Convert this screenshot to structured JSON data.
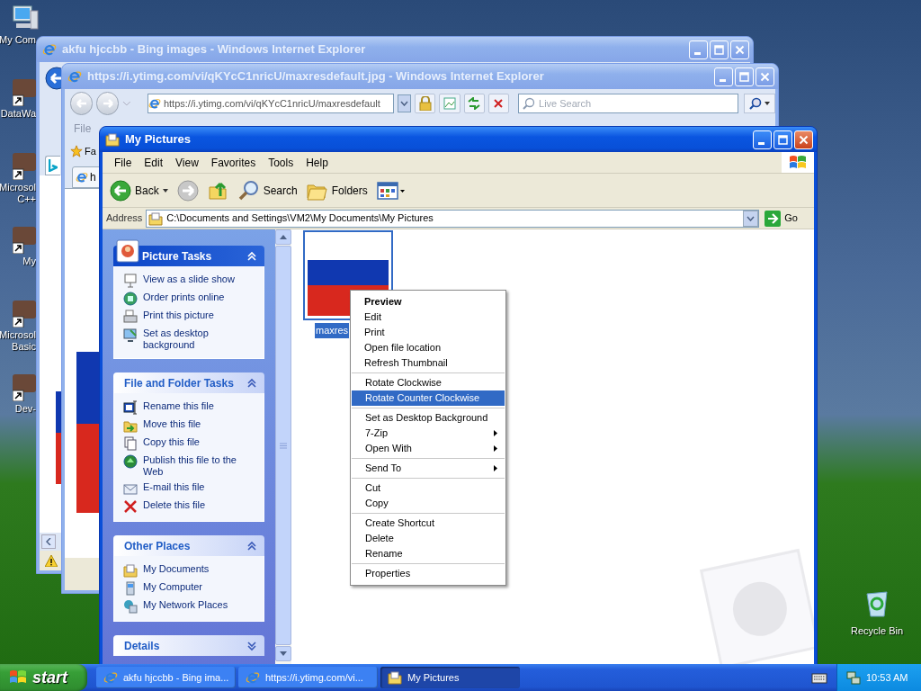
{
  "desktop": {
    "icons": [
      {
        "kind": "computer",
        "lines": [
          "My Com"
        ]
      },
      {
        "kind": "shortcut",
        "lines": [
          "DataWa"
        ]
      },
      {
        "kind": "shortcut",
        "lines": [
          "Microsol",
          "C++"
        ]
      },
      {
        "kind": "shortcut",
        "lines": [
          "My"
        ]
      },
      {
        "kind": "shortcut",
        "lines": [
          "Microsol",
          "Basic"
        ]
      },
      {
        "kind": "shortcut",
        "lines": [
          "Dev-"
        ]
      }
    ],
    "recycle_bin": {
      "label": "Recycle Bin"
    }
  },
  "browser_back": {
    "title": "akfu hjccbb - Bing images - Windows Internet Explorer"
  },
  "browser_front": {
    "title": "https://i.ytimg.com/vi/qKYcC1nricU/maxresdefault.jpg - Windows Internet Explorer",
    "address": "https://i.ytimg.com/vi/qKYcC1nricU/maxresdefault",
    "search": {
      "placeholder": "Live Search"
    },
    "menu": [
      "File"
    ],
    "favorites": "Fa",
    "tab": "h"
  },
  "explorer": {
    "title": "My Pictures",
    "menu": [
      "File",
      "Edit",
      "View",
      "Favorites",
      "Tools",
      "Help"
    ],
    "toolbar": [
      {
        "kind": "back",
        "label": "Back"
      },
      {
        "kind": "forward"
      },
      {
        "kind": "up"
      },
      {
        "kind": "search",
        "label": "Search"
      },
      {
        "kind": "folders",
        "label": "Folders"
      },
      {
        "kind": "views"
      }
    ],
    "address": {
      "label": "Address",
      "value": "C:\\Documents and Settings\\VM2\\My Documents\\My Pictures",
      "go": "Go"
    },
    "task_panels": [
      {
        "title": "Picture Tasks",
        "kind": "special",
        "expanded": true,
        "items": [
          {
            "kind": "slideshow",
            "label": "View as a slide show"
          },
          {
            "kind": "globe",
            "label": "Order prints online"
          },
          {
            "kind": "printer",
            "label": "Print this picture"
          },
          {
            "kind": "desktop",
            "label": "Set as desktop background"
          }
        ]
      },
      {
        "title": "File and Folder Tasks",
        "kind": "normal",
        "expanded": true,
        "items": [
          {
            "kind": "rename",
            "label": "Rename this file"
          },
          {
            "kind": "move",
            "label": "Move this file"
          },
          {
            "kind": "copy",
            "label": "Copy this file"
          },
          {
            "kind": "publish",
            "label": "Publish this file to the Web"
          },
          {
            "kind": "email",
            "label": "E-mail this file"
          },
          {
            "kind": "delete",
            "label": "Delete this file"
          }
        ]
      },
      {
        "title": "Other Places",
        "kind": "normal",
        "expanded": true,
        "items": [
          {
            "kind": "documents",
            "label": "My Documents"
          },
          {
            "kind": "computer",
            "label": "My Computer"
          },
          {
            "kind": "network",
            "label": "My Network Places"
          }
        ]
      },
      {
        "title": "Details",
        "kind": "normal",
        "expanded": false
      }
    ],
    "files": [
      {
        "name": "maxres",
        "selected": true
      }
    ]
  },
  "context_menu": {
    "groups": [
      [
        {
          "kind": "default",
          "label": "Preview",
          "selected": false,
          "submenu": false
        },
        {
          "kind": "item",
          "label": "Edit",
          "selected": false,
          "submenu": false
        },
        {
          "kind": "item",
          "label": "Print",
          "selected": false,
          "submenu": false
        },
        {
          "kind": "item",
          "label": "Open file location",
          "selected": false,
          "submenu": false
        },
        {
          "kind": "item",
          "label": "Refresh Thumbnail",
          "selected": false,
          "submenu": false
        }
      ],
      [
        {
          "kind": "item",
          "label": "Rotate Clockwise",
          "selected": false,
          "submenu": false
        },
        {
          "kind": "item",
          "label": "Rotate Counter Clockwise",
          "selected": true,
          "submenu": false
        }
      ],
      [
        {
          "kind": "item",
          "label": "Set as Desktop Background",
          "selected": false,
          "submenu": false
        },
        {
          "kind": "item",
          "label": "7-Zip",
          "selected": false,
          "submenu": true
        },
        {
          "kind": "item",
          "label": "Open With",
          "selected": false,
          "submenu": true
        }
      ],
      [
        {
          "kind": "item",
          "label": "Send To",
          "selected": false,
          "submenu": true
        }
      ],
      [
        {
          "kind": "item",
          "label": "Cut",
          "selected": false,
          "submenu": false
        },
        {
          "kind": "item",
          "label": "Copy",
          "selected": false,
          "submenu": false
        }
      ],
      [
        {
          "kind": "item",
          "label": "Create Shortcut",
          "selected": false,
          "submenu": false
        },
        {
          "kind": "item",
          "label": "Delete",
          "selected": false,
          "submenu": false
        },
        {
          "kind": "item",
          "label": "Rename",
          "selected": false,
          "submenu": false
        }
      ],
      [
        {
          "kind": "item",
          "label": "Properties",
          "selected": false,
          "submenu": false
        }
      ]
    ]
  },
  "taskbar": {
    "start": "start",
    "tasks": [
      {
        "kind": "browser",
        "label": "akfu hjccbb - Bing ima...",
        "selected": false
      },
      {
        "kind": "browser",
        "label": "https://i.ytimg.com/vi...",
        "selected": false
      },
      {
        "kind": "folder",
        "label": "My Pictures",
        "selected": true
      }
    ],
    "clock": "10:53 AM"
  }
}
